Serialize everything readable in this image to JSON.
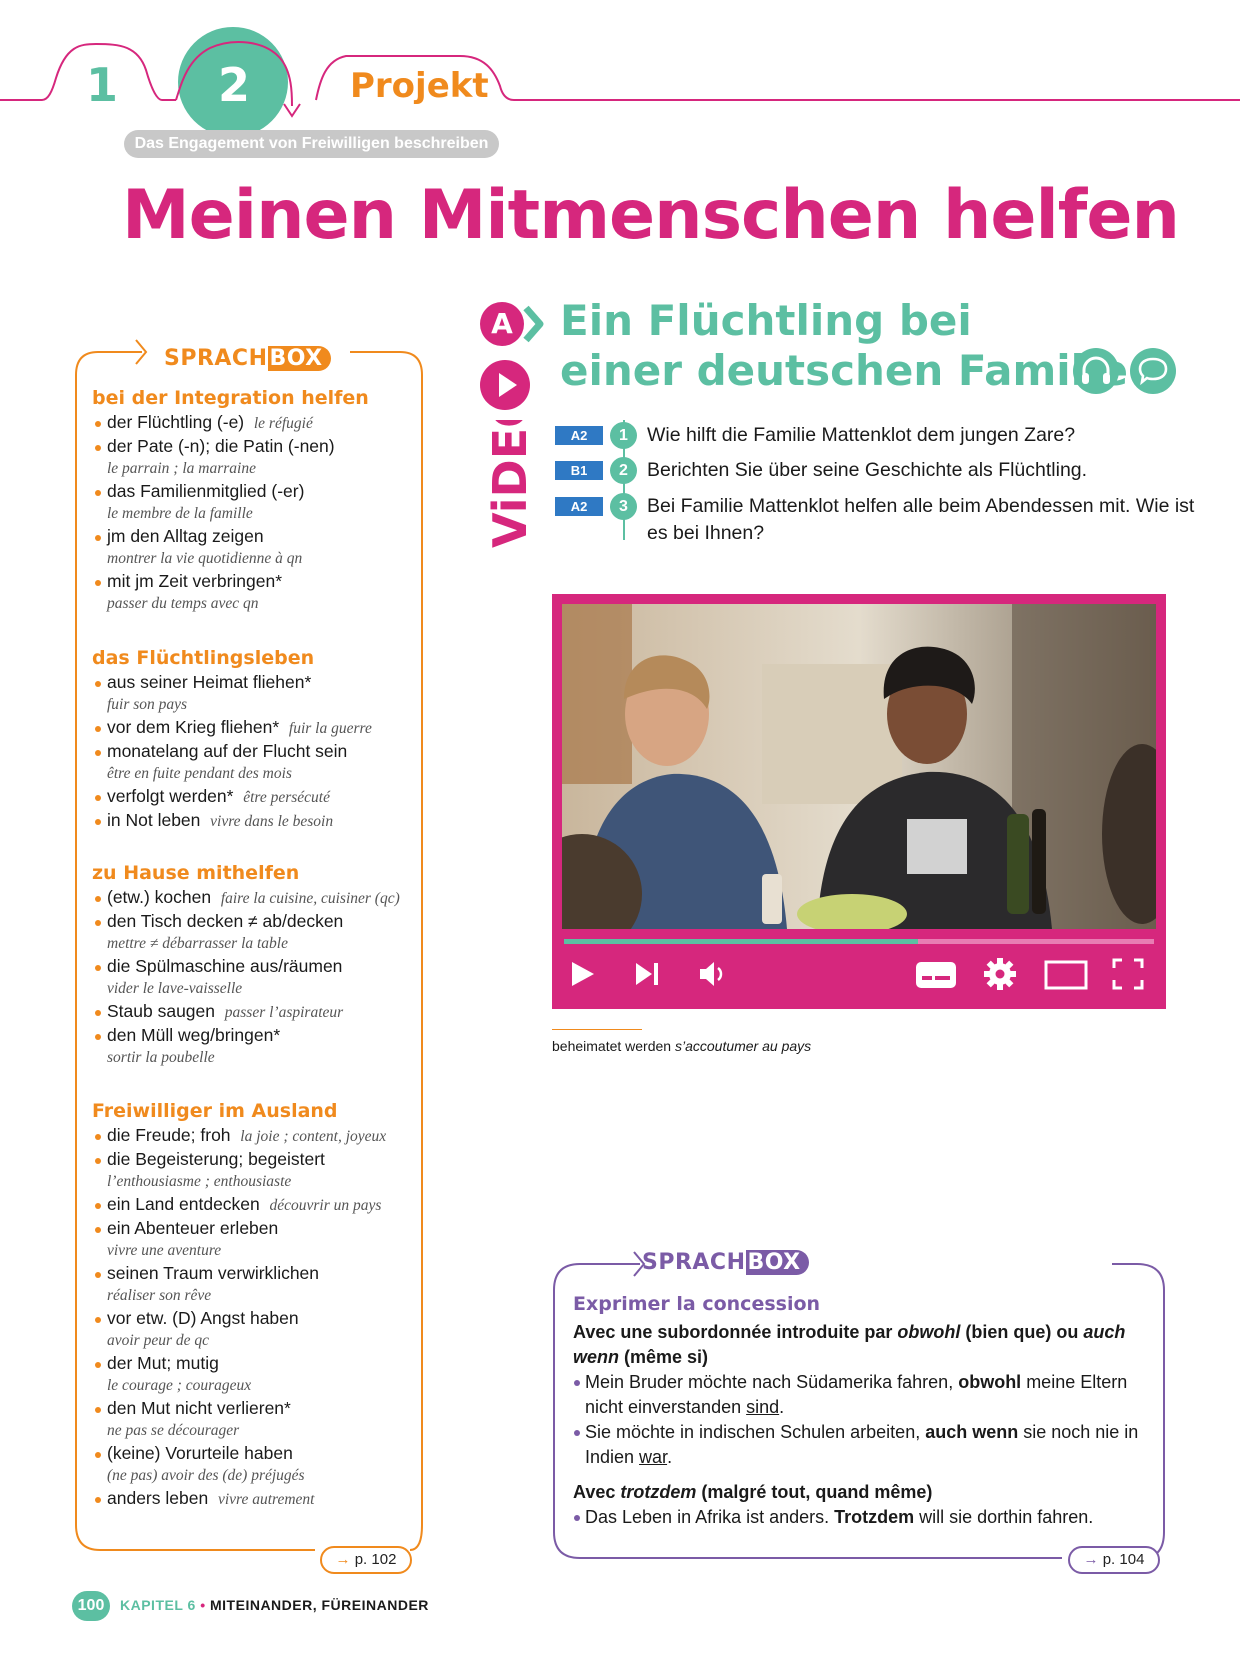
{
  "header": {
    "tab1": "1",
    "tab2": "2",
    "tab3": "Projekt",
    "subtitle": "Das Engagement von Freiwilligen beschreiben",
    "title": "Meinen Mitmenschen helfen"
  },
  "left_sprachbox": {
    "label_a": "SPRACH",
    "label_b": "BOX",
    "groups": [
      {
        "heading": "bei der Integration helfen",
        "items": [
          {
            "de": "der Flüchtling (-e)",
            "fr": "le réfugié",
            "inline": true
          },
          {
            "de": "der Pate (-n); die Patin (-nen)",
            "fr": "le parrain ; la marraine",
            "inline": false
          },
          {
            "de": "das Familienmitglied (-er)",
            "fr": "le membre de la famille",
            "inline": false
          },
          {
            "de": "jm den Alltag zeigen",
            "fr": "montrer la vie quotidienne à qn",
            "inline": false
          },
          {
            "de": "mit jm Zeit verbringen*",
            "fr": "passer du temps avec qn",
            "inline": false
          }
        ]
      },
      {
        "heading": "das Flüchtlingsleben",
        "items": [
          {
            "de": "aus seiner Heimat fliehen*",
            "fr": "fuir son pays",
            "inline": false
          },
          {
            "de": "vor dem Krieg fliehen*",
            "fr": "fuir la guerre",
            "inline": true
          },
          {
            "de": "monatelang auf der Flucht sein",
            "fr": "être en fuite pendant des mois",
            "inline": false
          },
          {
            "de": "verfolgt werden*",
            "fr": "être persécuté",
            "inline": true
          },
          {
            "de": "in Not leben",
            "fr": "vivre dans le besoin",
            "inline": true
          }
        ]
      },
      {
        "heading": "zu Hause mithelfen",
        "items": [
          {
            "de": "(etw.) kochen",
            "fr": "faire la cuisine, cuisiner (qc)",
            "inline": true
          },
          {
            "de": "den Tisch decken ≠ ab/decken",
            "fr": "mettre ≠ débarrasser la table",
            "inline": false
          },
          {
            "de": "die Spülmaschine aus/räumen",
            "fr": "vider le lave-vaisselle",
            "inline": false
          },
          {
            "de": "Staub saugen",
            "fr": "passer l’aspirateur",
            "inline": true
          },
          {
            "de": "den Müll weg/bringen*",
            "fr": "sortir la poubelle",
            "inline": false
          }
        ]
      },
      {
        "heading": "Freiwilliger im Ausland",
        "items": [
          {
            "de": "die Freude; froh",
            "fr": "la joie ; content, joyeux",
            "inline": true
          },
          {
            "de": "die Begeisterung; begeistert",
            "fr": "l’enthousiasme ; enthousiaste",
            "inline": false
          },
          {
            "de": "ein Land entdecken",
            "fr": "découvrir un pays",
            "inline": true
          },
          {
            "de": "ein Abenteuer erleben",
            "fr": "vivre une aventure",
            "inline": false
          },
          {
            "de": "seinen Traum verwirklichen",
            "fr": "réaliser son rêve",
            "inline": false
          },
          {
            "de": "vor etw. (D) Angst haben",
            "fr": "avoir peur de qc",
            "inline": false
          },
          {
            "de": "der Mut; mutig",
            "fr": "le courage ; courageux",
            "inline": false
          },
          {
            "de": "den Mut nicht verlieren*",
            "fr": "ne pas se décourager",
            "inline": false
          },
          {
            "de": "(keine) Vorurteile haben",
            "fr": "(ne pas) avoir des (de) préjugés",
            "inline": false
          },
          {
            "de": "anders leben",
            "fr": "vivre autrement",
            "inline": true
          }
        ]
      }
    ],
    "ref": "p. 102",
    "ref_arrow": "→"
  },
  "section_a": {
    "badge": "A",
    "title_line1": "Ein Flüchtling bei",
    "title_line2": "einer deutschen Familie",
    "video_label": "ViDEO",
    "icons": [
      "headphones-icon",
      "speech-bubble-icon",
      "play-icon"
    ],
    "tasks": [
      {
        "level": "A2",
        "num": "1",
        "text": "Wie hilft die Familie Mattenklot dem jungen Zare?"
      },
      {
        "level": "B1",
        "num": "2",
        "text": "Berichten Sie über seine Geschichte als Flüchtling."
      },
      {
        "level": "A2",
        "num": "3",
        "text": "Bei Familie Mattenklot helfen alle beim Abendessen mit. Wie ist es bei Ihnen?"
      }
    ]
  },
  "video_player": {
    "progress": 0.6,
    "controls": [
      "play-icon",
      "skip-next-icon",
      "volume-icon",
      "subtitles-icon",
      "settings-icon",
      "theater-mode-icon",
      "fullscreen-icon"
    ]
  },
  "footnote": {
    "de": "beheimatet werden",
    "fr": "s’accoutumer au pays"
  },
  "right_sprachbox": {
    "label_a": "SPRACH",
    "label_b": "BOX",
    "heading": "Exprimer la concession",
    "intro1_a": "Avec une subordonnée introduite par ",
    "intro1_b": "obwohl",
    "intro1_c": " (bien que) ou ",
    "intro1_d": "auch wenn",
    "intro1_e": " (même si)",
    "ex1_a": "Mein Bruder möchte nach Südamerika fahren, ",
    "ex1_b": "obwohl",
    "ex1_c": " meine Eltern nicht einverstanden ",
    "ex1_d": "sind",
    "ex1_e": ".",
    "ex2_a": "Sie möchte in indischen Schulen arbeiten, ",
    "ex2_b": "auch wenn",
    "ex2_c": " sie noch nie in Indien ",
    "ex2_d": "war",
    "ex2_e": ".",
    "intro2_a": "Avec ",
    "intro2_b": "trotzdem",
    "intro2_c": " (malgré tout, quand même)",
    "ex3_a": "Das Leben in Afrika ist anders. ",
    "ex3_b": "Trotzdem",
    "ex3_c": " will sie dorthin fahren.",
    "ref": "p. 104",
    "ref_arrow": "→"
  },
  "footer": {
    "page": "100",
    "chapter_word": "KAPITEL 6",
    "separator": "•",
    "chapter_title": "MITEINANDER, FÜREINANDER"
  },
  "colors": {
    "magenta": "#d6277d",
    "teal": "#5cbfa2",
    "orange": "#f08a1d",
    "purple": "#7b5ba6",
    "level_blue": "#2f79c4"
  }
}
